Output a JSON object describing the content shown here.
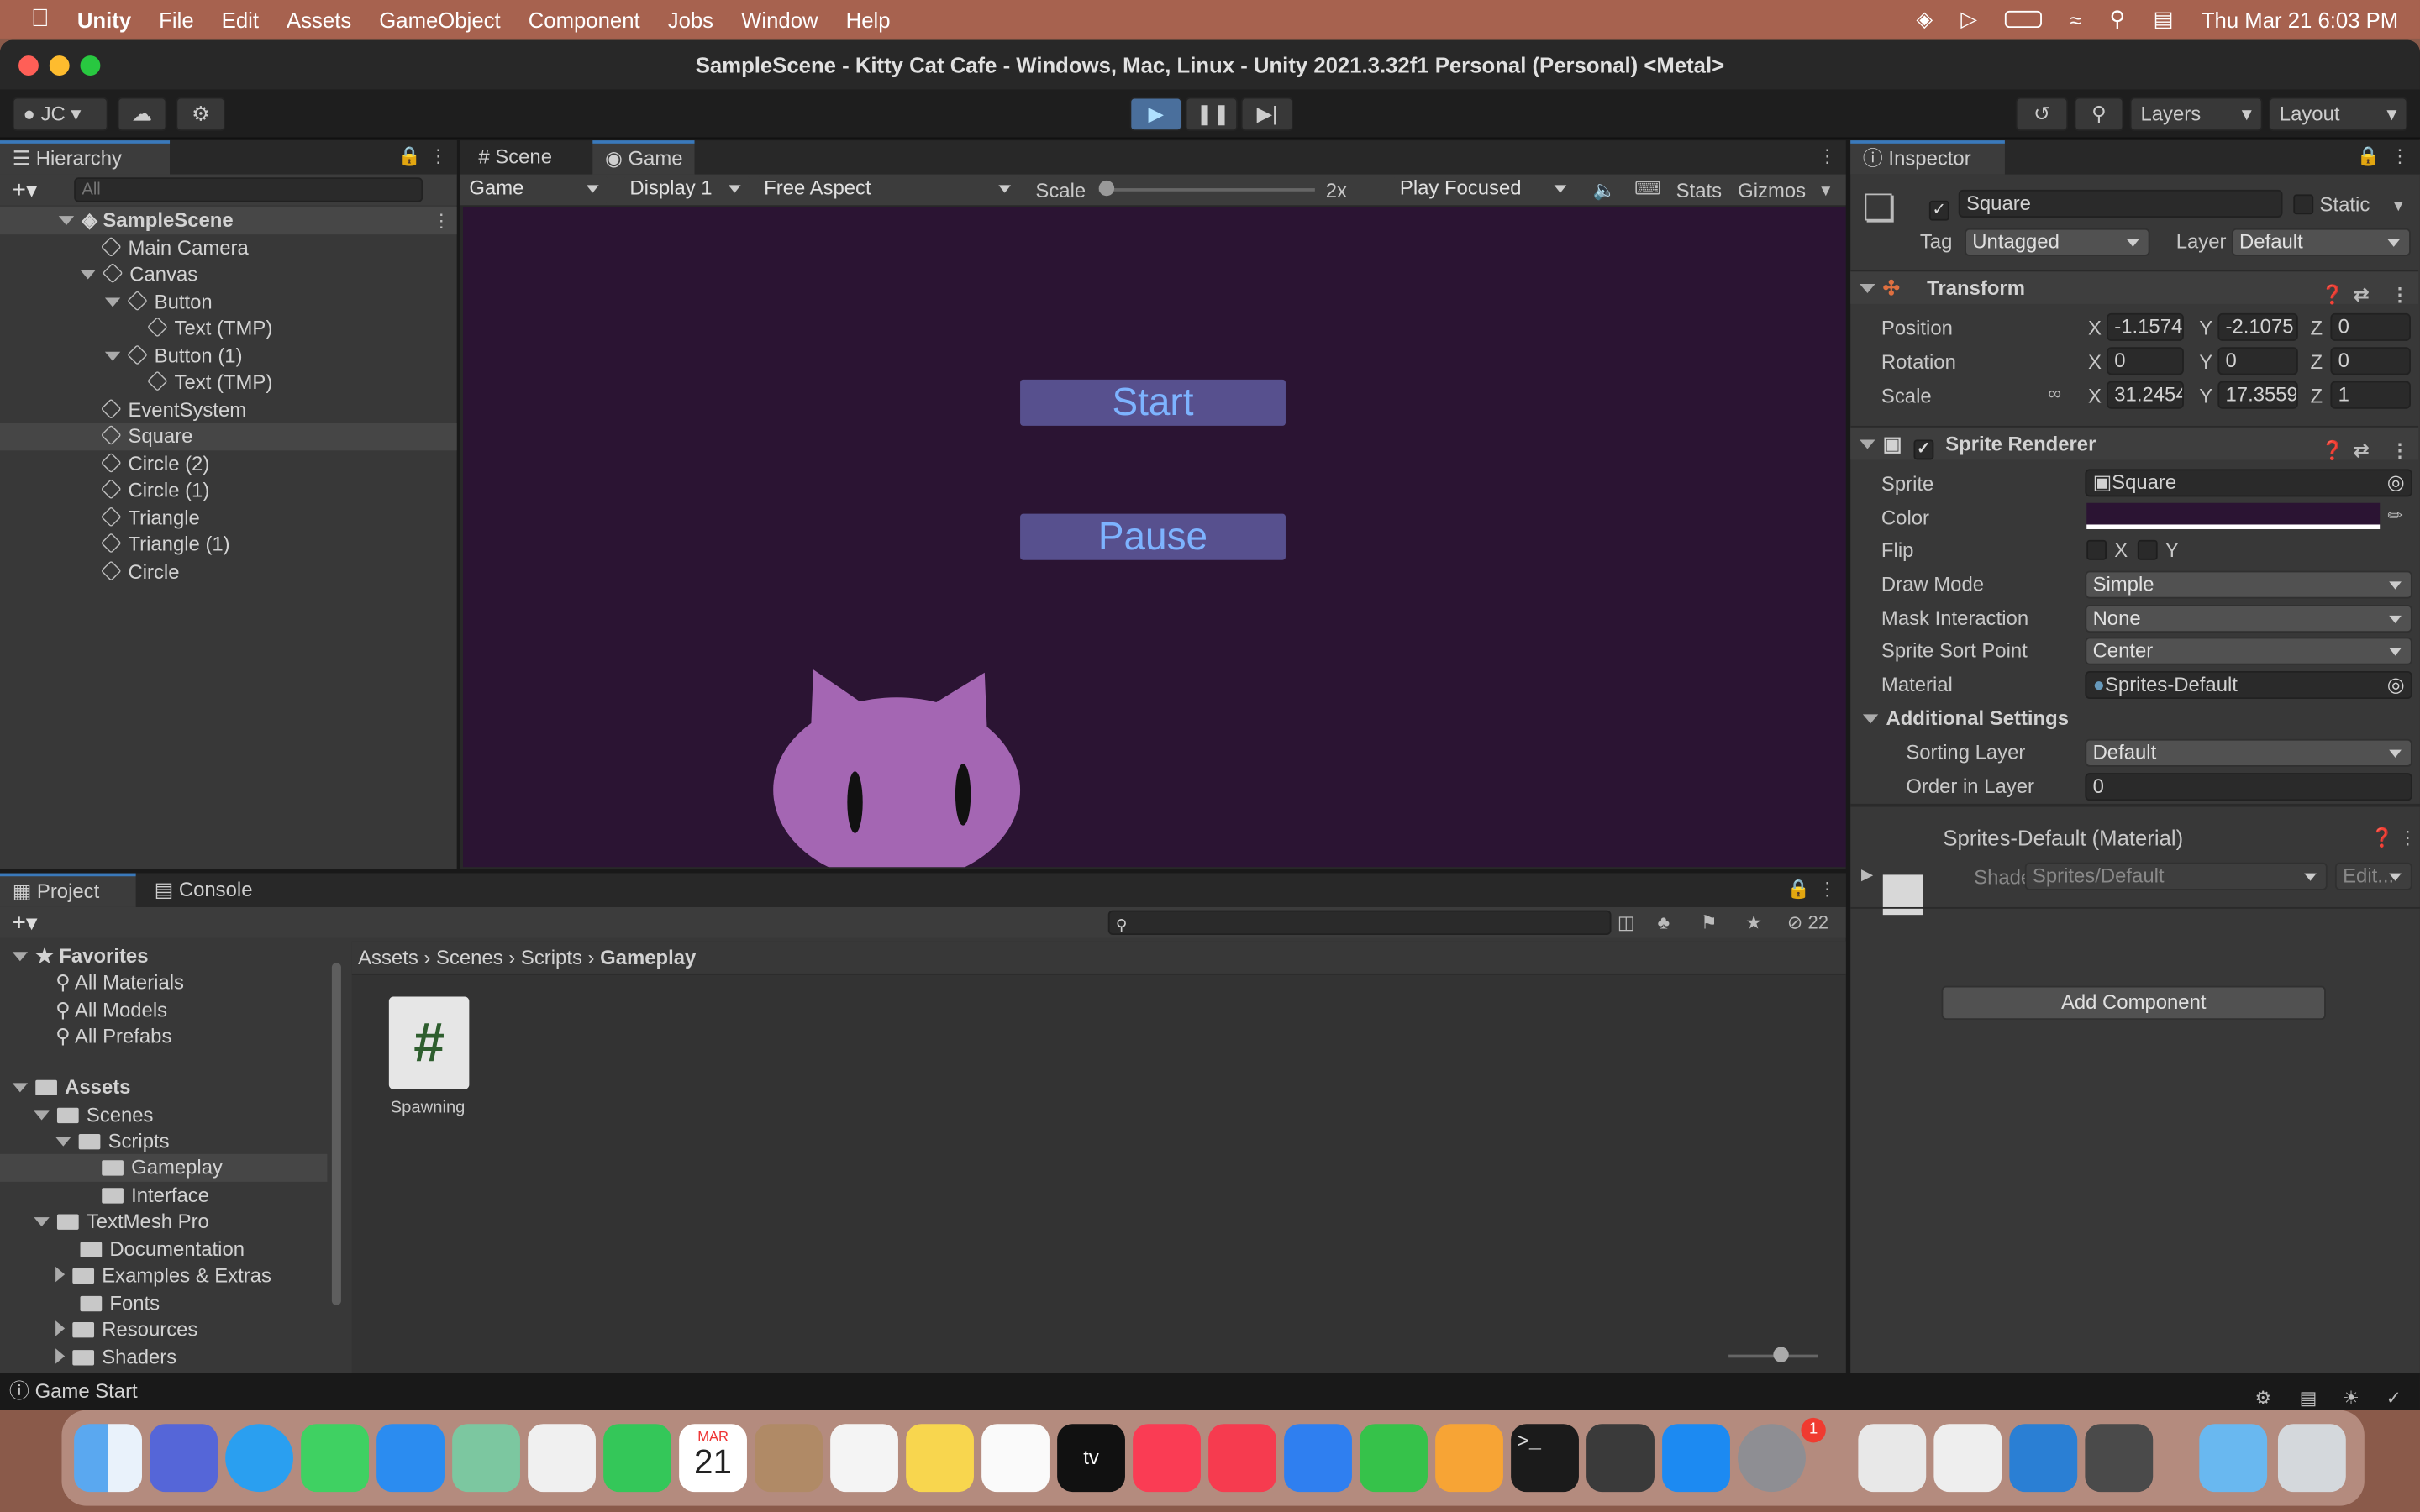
{
  "menubar": {
    "app": "Unity",
    "items": [
      "File",
      "Edit",
      "Assets",
      "GameObject",
      "Component",
      "Jobs",
      "Window",
      "Help"
    ],
    "clock": "Thu Mar 21  6:03 PM"
  },
  "window": {
    "title": "SampleScene - Kitty Cat Cafe - Windows, Mac, Linux - Unity 2021.3.32f1 Personal (Personal) <Metal>"
  },
  "toolbar": {
    "account": "JC",
    "layers": "Layers",
    "layout": "Layout"
  },
  "hierarchy": {
    "tab": "Hierarchy",
    "search_placeholder": "All",
    "scene": "SampleScene",
    "items": [
      "Main Camera",
      "Canvas",
      "Button",
      "Text (TMP)",
      "Button (1)",
      "Text (TMP)",
      "EventSystem",
      "Square",
      "Circle (2)",
      "Circle (1)",
      "Triangle",
      "Triangle (1)",
      "Circle"
    ]
  },
  "game": {
    "tabs": [
      "Scene",
      "Game"
    ],
    "mode": "Game",
    "display": "Display 1",
    "aspect": "Free Aspect",
    "scale_label": "Scale",
    "scale_value": "2x",
    "play_mode": "Play Focused",
    "stats": "Stats",
    "gizmos": "Gizmos",
    "buttons": [
      "Start",
      "Pause"
    ],
    "bg_color": "#2b1433",
    "cat_color": "#a466b3"
  },
  "inspector": {
    "tab": "Inspector",
    "object_name": "Square",
    "static_label": "Static",
    "tag_label": "Tag",
    "tag": "Untagged",
    "layer_label": "Layer",
    "layer": "Default",
    "transform": {
      "title": "Transform",
      "position_label": "Position",
      "rotation_label": "Rotation",
      "scale_label": "Scale",
      "position": {
        "x": "-1.1574",
        "y": "-2.1075",
        "z": "0"
      },
      "rotation": {
        "x": "0",
        "y": "0",
        "z": "0"
      },
      "scale": {
        "x": "31.2454",
        "y": "17.3559",
        "z": "1"
      }
    },
    "sprite_renderer": {
      "title": "Sprite Renderer",
      "sprite_label": "Sprite",
      "sprite": "Square",
      "color_label": "Color",
      "flip_label": "Flip",
      "flip_x": "X",
      "flip_y": "Y",
      "draw_mode_label": "Draw Mode",
      "draw_mode": "Simple",
      "mask_label": "Mask Interaction",
      "mask": "None",
      "sort_point_label": "Sprite Sort Point",
      "sort_point": "Center",
      "material_label": "Material",
      "material": "Sprites-Default",
      "additional": "Additional Settings",
      "sorting_layer_label": "Sorting Layer",
      "sorting_layer": "Default",
      "order_label": "Order in Layer",
      "order": "0"
    },
    "material": {
      "title": "Sprites-Default (Material)",
      "shader_label": "Shader",
      "shader": "Sprites/Default",
      "edit": "Edit..."
    },
    "add_component": "Add Component"
  },
  "project": {
    "tabs": [
      "Project",
      "Console"
    ],
    "hidden_count": "22",
    "breadcrumb": [
      "Assets",
      "Scenes",
      "Scripts",
      "Gameplay"
    ],
    "favorites": "Favorites",
    "fav_items": [
      "All Materials",
      "All Models",
      "All Prefabs"
    ],
    "assets": "Assets",
    "tree": [
      "Scenes",
      "Scripts",
      "Gameplay",
      "Interface",
      "TextMesh Pro",
      "Documentation",
      "Examples & Extras",
      "Fonts",
      "Resources",
      "Shaders"
    ],
    "file": "Spawning"
  },
  "status": "Game Start",
  "dock": {
    "calendar_month": "MAR",
    "calendar_day": "21",
    "badge": "1"
  }
}
